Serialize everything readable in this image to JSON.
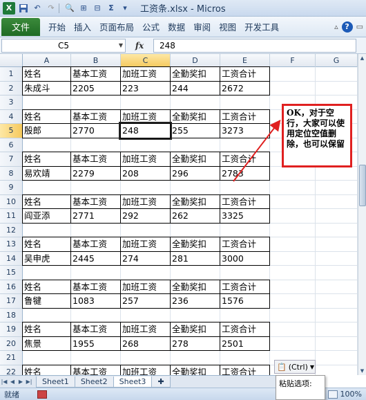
{
  "window": {
    "title": "工资条.xlsx - Micros",
    "app_icon": "excel-icon"
  },
  "ribbon": {
    "file_tab": "文件",
    "tabs": [
      "开始",
      "插入",
      "页面布局",
      "公式",
      "数据",
      "审阅",
      "视图",
      "开发工具"
    ]
  },
  "formula_bar": {
    "name_box": "C5",
    "fx_label": "fx",
    "value": "248"
  },
  "columns": [
    "A",
    "B",
    "C",
    "D",
    "E",
    "F",
    "G"
  ],
  "selected_column": "C",
  "selected_row": "5",
  "active_cell": "C5",
  "rows": [
    {
      "num": "1",
      "cells": [
        "姓名",
        "基本工资",
        "加班工资",
        "全勤奖扣",
        "工资合计"
      ],
      "bordered": true
    },
    {
      "num": "2",
      "cells": [
        "朱成斗",
        "2205",
        "223",
        "244",
        "2672"
      ],
      "bordered": true
    },
    {
      "num": "3",
      "cells": [],
      "bordered": false
    },
    {
      "num": "4",
      "cells": [
        "姓名",
        "基本工资",
        "加班工资",
        "全勤奖扣",
        "工资合计"
      ],
      "bordered": true
    },
    {
      "num": "5",
      "cells": [
        "殷郎",
        "2770",
        "248",
        "255",
        "3273"
      ],
      "bordered": true
    },
    {
      "num": "6",
      "cells": [],
      "bordered": false
    },
    {
      "num": "7",
      "cells": [
        "姓名",
        "基本工资",
        "加班工资",
        "全勤奖扣",
        "工资合计"
      ],
      "bordered": true
    },
    {
      "num": "8",
      "cells": [
        "易欢靖",
        "2279",
        "208",
        "296",
        "2783"
      ],
      "bordered": true
    },
    {
      "num": "9",
      "cells": [],
      "bordered": false
    },
    {
      "num": "10",
      "cells": [
        "姓名",
        "基本工资",
        "加班工资",
        "全勤奖扣",
        "工资合计"
      ],
      "bordered": true
    },
    {
      "num": "11",
      "cells": [
        "阎亚添",
        "2771",
        "292",
        "262",
        "3325"
      ],
      "bordered": true
    },
    {
      "num": "12",
      "cells": [],
      "bordered": false
    },
    {
      "num": "13",
      "cells": [
        "姓名",
        "基本工资",
        "加班工资",
        "全勤奖扣",
        "工资合计"
      ],
      "bordered": true
    },
    {
      "num": "14",
      "cells": [
        "吴申虎",
        "2445",
        "274",
        "281",
        "3000"
      ],
      "bordered": true
    },
    {
      "num": "15",
      "cells": [],
      "bordered": false
    },
    {
      "num": "16",
      "cells": [
        "姓名",
        "基本工资",
        "加班工资",
        "全勤奖扣",
        "工资合计"
      ],
      "bordered": true
    },
    {
      "num": "17",
      "cells": [
        "鲁犍",
        "1083",
        "257",
        "236",
        "1576"
      ],
      "bordered": true
    },
    {
      "num": "18",
      "cells": [],
      "bordered": false
    },
    {
      "num": "19",
      "cells": [
        "姓名",
        "基本工资",
        "加班工资",
        "全勤奖扣",
        "工资合计"
      ],
      "bordered": true
    },
    {
      "num": "20",
      "cells": [
        "焦景",
        "1955",
        "268",
        "278",
        "2501"
      ],
      "bordered": true
    },
    {
      "num": "21",
      "cells": [],
      "bordered": false
    },
    {
      "num": "22",
      "cells": [
        "姓名",
        "基本工资",
        "加班工资",
        "全勤奖扣",
        "工资合计"
      ],
      "bordered": true
    }
  ],
  "callout": {
    "text": "OK，对于空行，大家可以使用定位空值删除，也可以保留",
    "color": "#e02020"
  },
  "paste": {
    "button_label": "(Ctrl)",
    "menu_label": "粘贴选项:"
  },
  "sheets": [
    "Sheet1",
    "Sheet2",
    "Sheet3"
  ],
  "active_sheet": "Sheet3",
  "status": {
    "ready": "就绪",
    "zoom": "100%"
  }
}
